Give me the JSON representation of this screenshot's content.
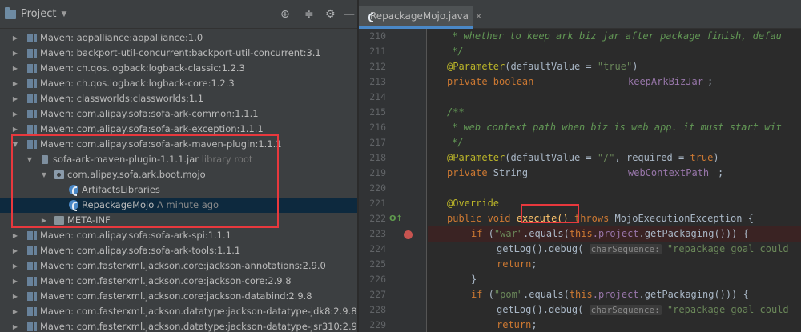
{
  "project_panel": {
    "title": "Project",
    "tree": [
      {
        "label": "Maven: aopalliance:aopalliance:1.0",
        "icon": "library-icon",
        "expanded": false
      },
      {
        "label": "Maven: backport-util-concurrent:backport-util-concurrent:3.1",
        "icon": "library-icon",
        "expanded": false
      },
      {
        "label": "Maven: ch.qos.logback:logback-classic:1.2.3",
        "icon": "library-icon",
        "expanded": false
      },
      {
        "label": "Maven: ch.qos.logback:logback-core:1.2.3",
        "icon": "library-icon",
        "expanded": false
      },
      {
        "label": "Maven: classworlds:classworlds:1.1",
        "icon": "library-icon",
        "expanded": false
      },
      {
        "label": "Maven: com.alipay.sofa:sofa-ark-common:1.1.1",
        "icon": "library-icon",
        "expanded": false
      },
      {
        "label": "Maven: com.alipay.sofa:sofa-ark-exception:1.1.1",
        "icon": "library-icon",
        "expanded": false
      },
      {
        "label": "Maven: com.alipay.sofa:sofa-ark-maven-plugin:1.1.1",
        "icon": "library-icon",
        "expanded": true
      },
      {
        "label": "sofa-ark-maven-plugin-1.1.1.jar",
        "suffix": "library root",
        "icon": "jar-icon",
        "expanded": true
      },
      {
        "label": "com.alipay.sofa.ark.boot.mojo",
        "icon": "package-icon",
        "expanded": true
      },
      {
        "label": "ArtifactsLibraries",
        "icon": "class-icon"
      },
      {
        "label": "RepackageMojo",
        "suffix": "A minute ago",
        "icon": "class-icon",
        "selected": true
      },
      {
        "label": "META-INF",
        "icon": "folder-icon",
        "expanded": false
      },
      {
        "label": "Maven: com.alipay.sofa:sofa-ark-spi:1.1.1",
        "icon": "library-icon",
        "expanded": false
      },
      {
        "label": "Maven: com.alipay.sofa:sofa-ark-tools:1.1.1",
        "icon": "library-icon",
        "expanded": false
      },
      {
        "label": "Maven: com.fasterxml.jackson.core:jackson-annotations:2.9.0",
        "icon": "library-icon",
        "expanded": false
      },
      {
        "label": "Maven: com.fasterxml.jackson.core:jackson-core:2.9.8",
        "icon": "library-icon",
        "expanded": false
      },
      {
        "label": "Maven: com.fasterxml.jackson.core:jackson-databind:2.9.8",
        "icon": "library-icon",
        "expanded": false
      },
      {
        "label": "Maven: com.fasterxml.jackson.datatype:jackson-datatype-jdk8:2.9.8",
        "icon": "library-icon",
        "expanded": false
      },
      {
        "label": "Maven: com.fasterxml.jackson.datatype:jackson-datatype-jsr310:2.9.8",
        "icon": "library-icon",
        "expanded": false
      }
    ]
  },
  "editor": {
    "tab_label": "RepackageMojo.java",
    "line_numbers": [
      "210",
      "211",
      "212",
      "213",
      "214",
      "215",
      "216",
      "217",
      "218",
      "219",
      "220",
      "221",
      "222",
      "223",
      "224",
      "225",
      "226",
      "227",
      "228",
      "229",
      "230"
    ],
    "code": {
      "l210": "* whether to keep ark biz jar after package finish, defau",
      "l211": "*/",
      "l212_ann": "@Parameter",
      "l212_a": "(defaultValue = ",
      "l212_s": "\"true\"",
      "l212_b": ")",
      "l213_kw": "private boolean",
      "l213_f": "keepArkBizJar",
      "l213_end": ";",
      "l215": "/**",
      "l216": "* web context path when biz is web app. it must start wit",
      "l217": "*/",
      "l218_ann": "@Parameter",
      "l218_a": "(defaultValue = ",
      "l218_s": "\"/\"",
      "l218_b": ", required = ",
      "l218_kw": "true",
      "l218_c": ")",
      "l219_kw": "private",
      "l219_type": " String",
      "l219_f": "webContextPath",
      "l219_end": ";",
      "l221_ann": "@Override",
      "l222_kw1": "public void",
      "l222_m": "execute()",
      "l222_kw2": " throws",
      "l222_t": " MojoExecutionException {",
      "l223_kw": "if",
      "l223_a": " (",
      "l223_s": "\"war\"",
      "l223_b": ".equals(",
      "l223_kw2": "this",
      "l223_f": ".project",
      "l223_c": ".getPackaging())) {",
      "l224_a": "getLog().debug(",
      "l224_hint": "charSequence:",
      "l224_s": " \"repackage goal could",
      "l225_kw": "return",
      "l225_end": ";",
      "l226": "}",
      "l227_kw": "if",
      "l227_a": " (",
      "l227_s": "\"pom\"",
      "l227_b": ".equals(",
      "l227_kw2": "this",
      "l227_f": ".project",
      "l227_c": ".getPackaging())) {",
      "l228_a": "getLog().debug(",
      "l228_hint": "charSequence:",
      "l228_s": " \"repackage goal could",
      "l229_kw": "return",
      "l229_end": ";",
      "l230": "}"
    }
  },
  "colors": {
    "highlight_box": "#e8383d",
    "breakpoint": "#c75450",
    "selection": "#0d293e"
  }
}
